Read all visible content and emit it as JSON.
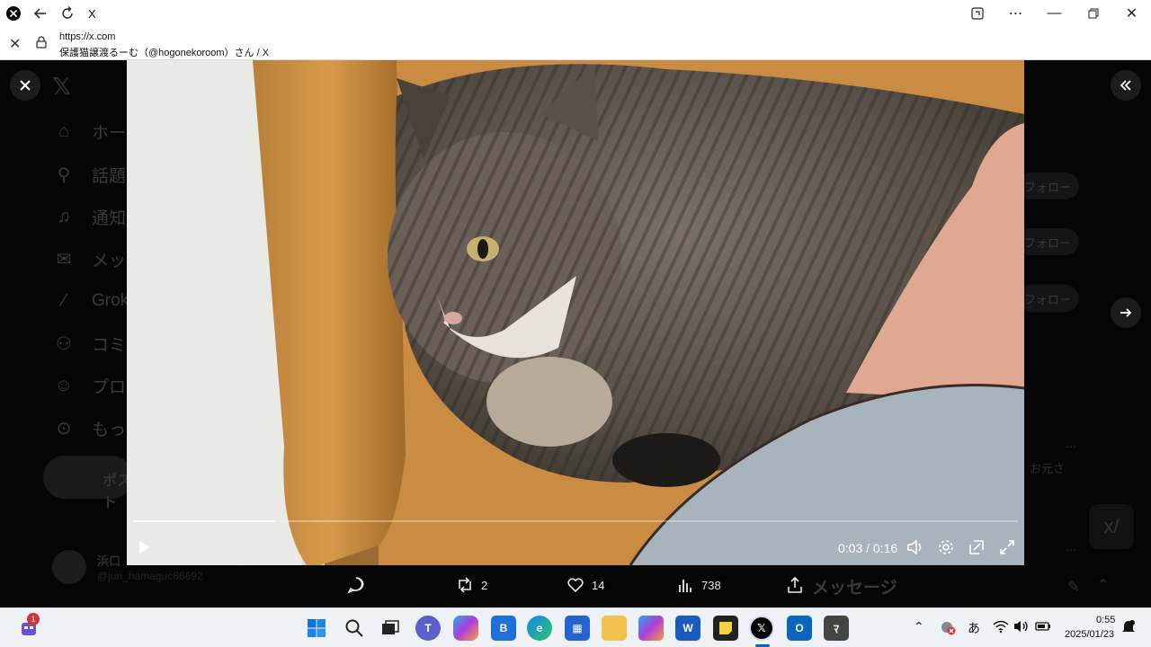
{
  "browser": {
    "tab_title": "X",
    "url": "https://x.com",
    "page_title": "保護猫譲渡るーむ（@hogonekoroom）さん / X"
  },
  "sidebar": {
    "items": [
      {
        "label": "ホーム",
        "icon": "home-icon"
      },
      {
        "label": "話題を検索",
        "icon": "search-icon"
      },
      {
        "label": "通知",
        "icon": "bell-icon"
      },
      {
        "label": "メッセージ",
        "icon": "mail-icon"
      },
      {
        "label": "Grok",
        "icon": "grok-icon"
      },
      {
        "label": "コミュニティ",
        "icon": "community-icon"
      },
      {
        "label": "プロフィール",
        "icon": "profile-icon"
      },
      {
        "label": "もっと見る",
        "icon": "more-icon"
      }
    ],
    "post_label": "ポスト"
  },
  "right_panel": {
    "follow_label": "フォロー",
    "more_dots": "…",
    "partial_text": "お元さ"
  },
  "bg_user": {
    "name": "浜口",
    "handle": "@jun_hamaguc86692"
  },
  "video": {
    "time_current": "0:03",
    "time_total": "0:16",
    "time_label": "0:03 / 0:16",
    "progress": 0.16
  },
  "actions": {
    "reply_count": "",
    "repost_count": "2",
    "like_count": "14",
    "views_count": "738"
  },
  "messages_label": "メッセージ",
  "taskbar": {
    "notification_badge": "1",
    "ime": "あ",
    "time": "0:55",
    "date": "2025/01/23"
  },
  "colors": {
    "accent": "#1d9bf0",
    "background": "#000000",
    "badge": "#d13438"
  }
}
